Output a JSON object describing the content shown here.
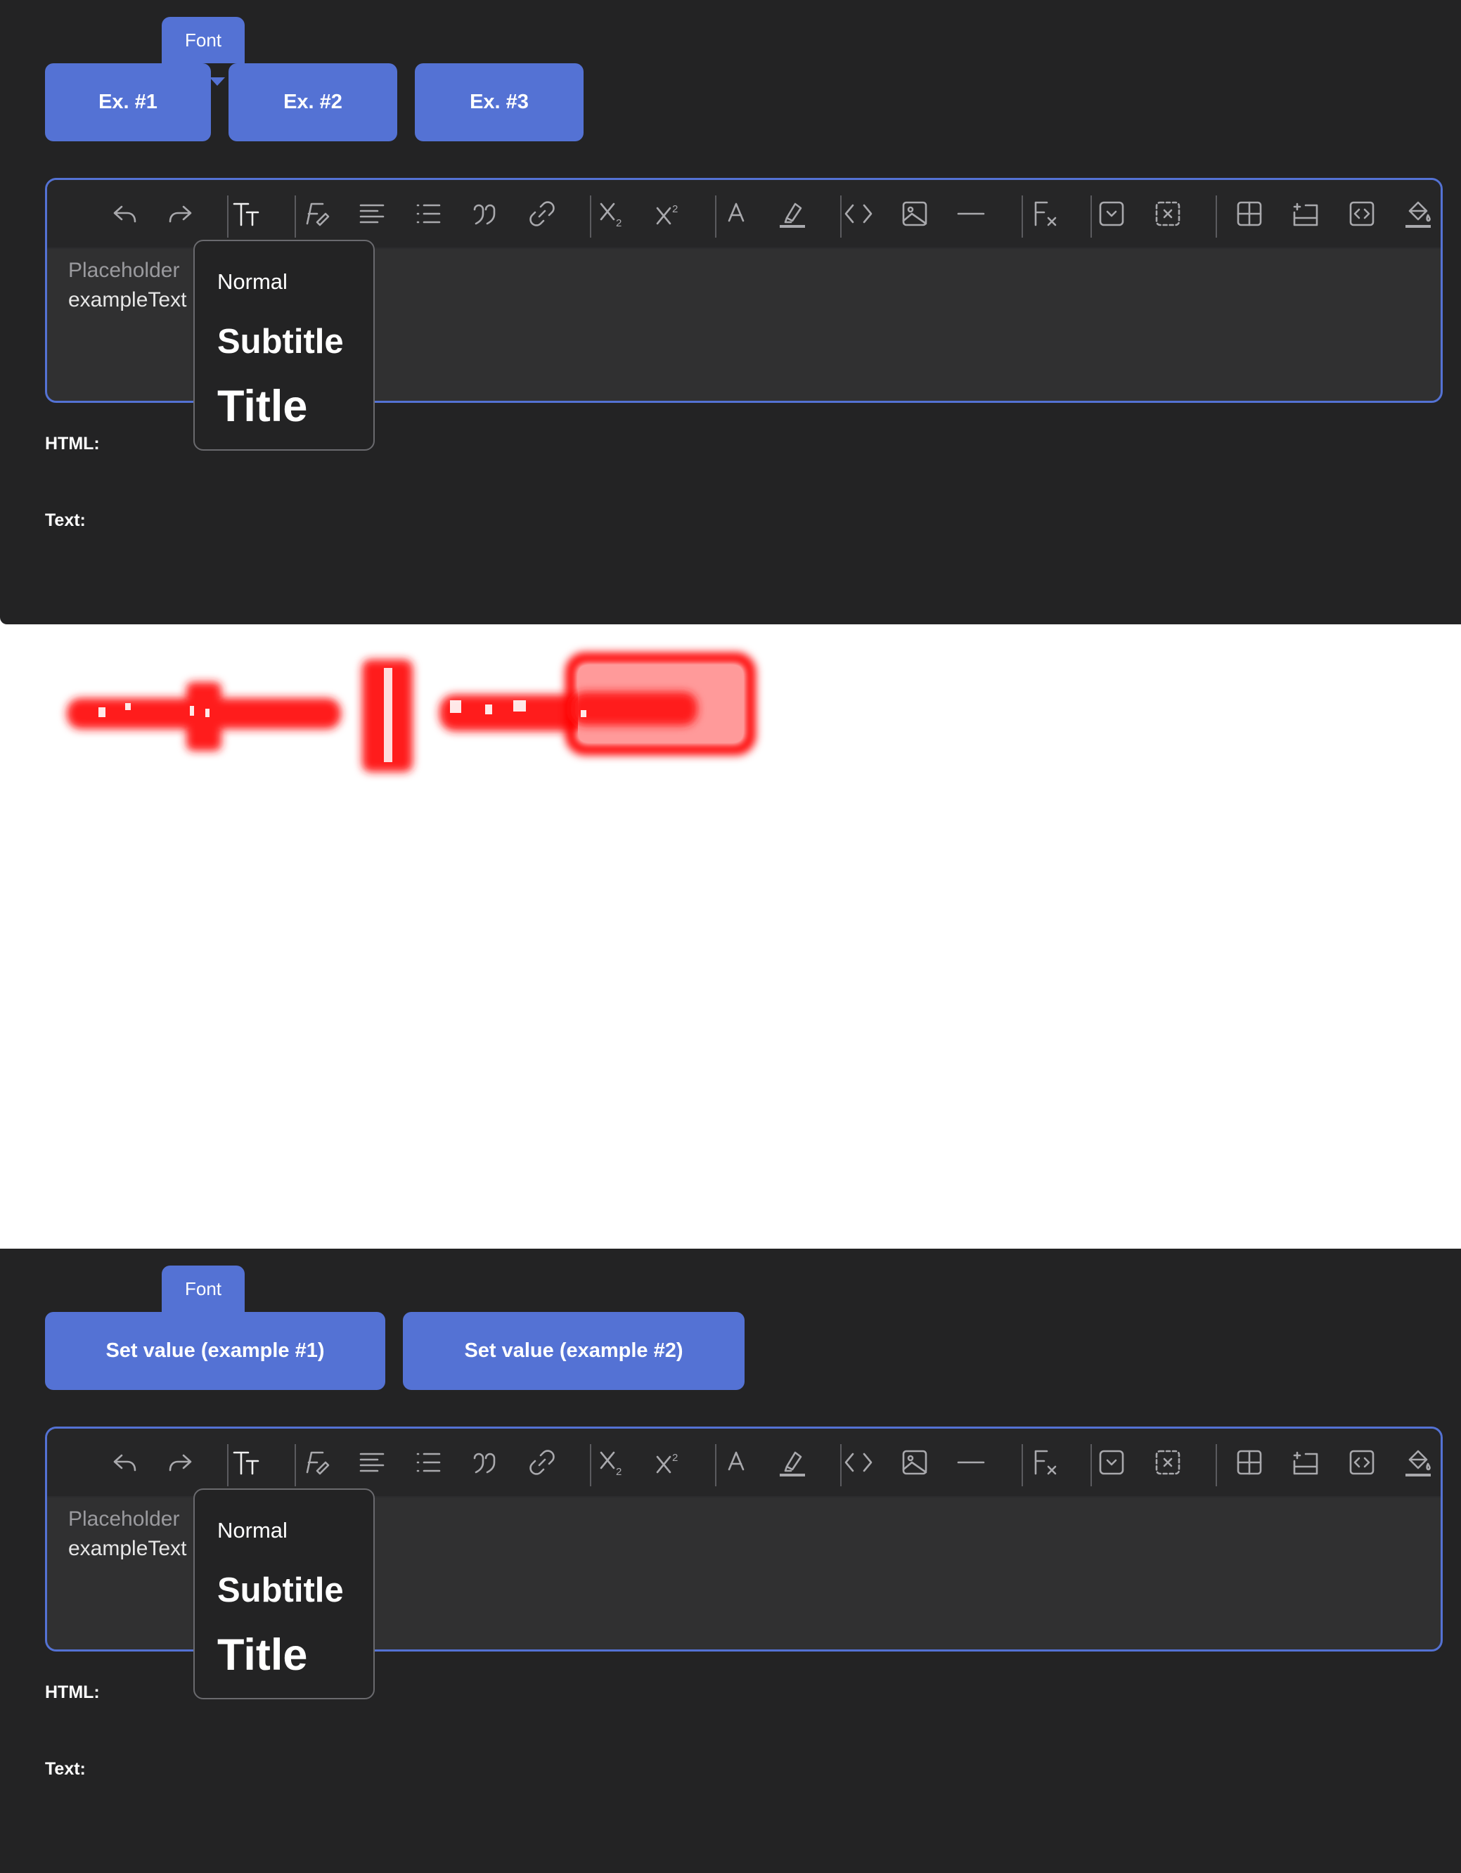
{
  "panels": [
    {
      "tooltip": "Font",
      "buttons": [
        "Ex. #1",
        "Ex. #2",
        "Ex. #3"
      ],
      "editor": {
        "placeholder": "Placeholder",
        "value": "exampleText"
      },
      "font_menu": {
        "options": [
          "Normal",
          "Subtitle",
          "Title"
        ]
      },
      "output_labels": {
        "html": "HTML:",
        "text": "Text:"
      }
    },
    {
      "tooltip": "Font",
      "buttons": [
        "Set value (example #1)",
        "Set value (example #2)"
      ],
      "editor": {
        "placeholder": "Placeholder",
        "value": "exampleText"
      },
      "font_menu": {
        "options": [
          "Normal",
          "Subtitle",
          "Title"
        ]
      },
      "output_labels": {
        "html": "HTML:",
        "text": "Text:"
      }
    }
  ],
  "toolbar_icons": [
    "undo-icon",
    "redo-icon",
    "font-size-icon",
    "clear-format-icon",
    "align-icon",
    "list-icon",
    "quote-icon",
    "link-icon",
    "subscript-icon",
    "superscript-icon",
    "font-color-icon",
    "highlight-icon",
    "code-icon",
    "image-icon",
    "horizontal-rule-icon",
    "formula-icon",
    "dropdown-field-icon",
    "remove-field-icon",
    "table-icon",
    "insert-row-icon",
    "embed-icon",
    "fill-color-icon"
  ],
  "colors": {
    "accent": "#5472d4",
    "background": "#232324",
    "highlight_red": "#ff0000"
  }
}
